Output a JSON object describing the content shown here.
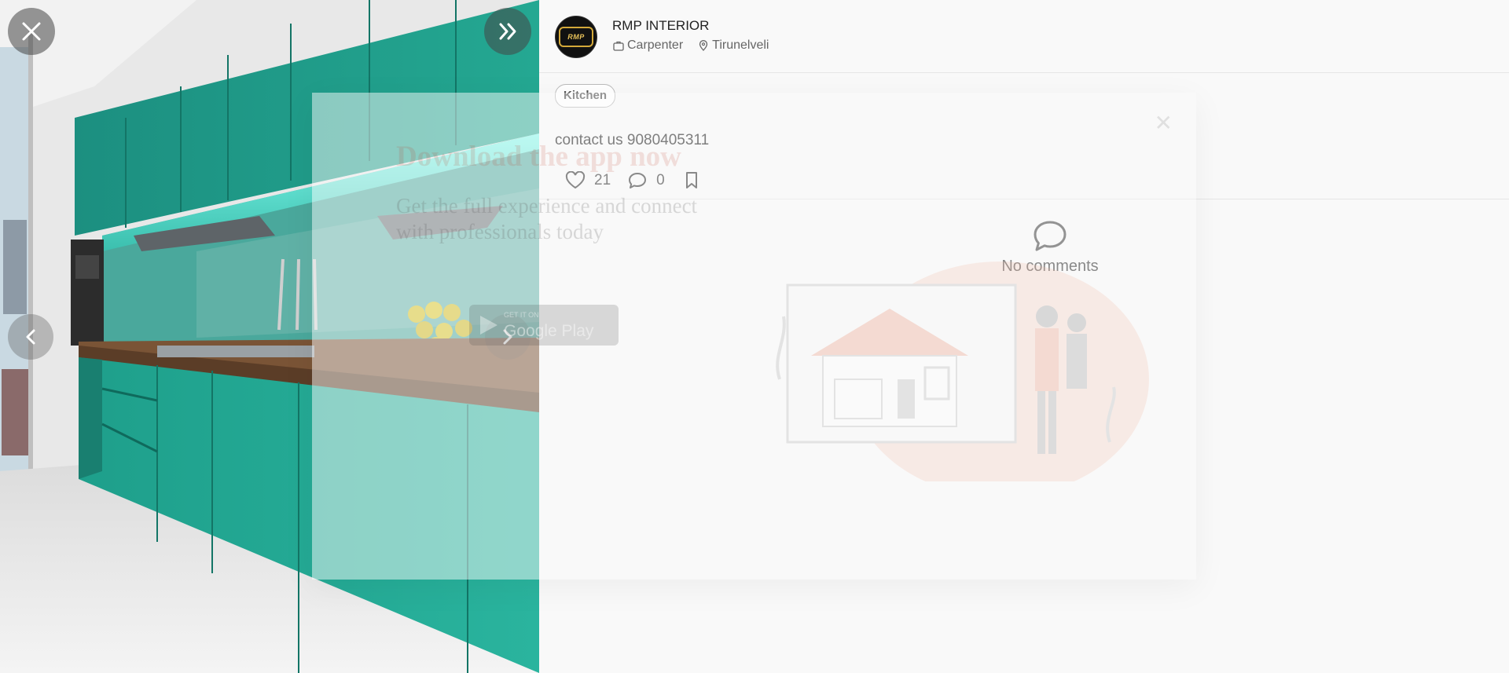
{
  "viewer": {
    "close_icon": "close-icon",
    "expand_icon": "double-chevron-right-icon",
    "prev_icon": "chevron-left-icon",
    "next_icon": "chevron-right-icon"
  },
  "post": {
    "author_name": "RMP INTERIOR",
    "avatar_text": "RMP",
    "profession": "Carpenter",
    "location": "Tirunelveli",
    "tag": "Kitchen",
    "caption": "contact us 9080405311",
    "likes": "21",
    "comments": "0"
  },
  "comments_section": {
    "empty_text": "No comments"
  },
  "popup": {
    "title": "Download the app now",
    "subtitle": "Get the full experience and connect with professionals today",
    "badge_small": "GET IT ON",
    "badge_big": "Google Play"
  },
  "colors": {
    "cabinet": "#1f9a87",
    "accent_glow": "#4ff0dc",
    "panel_bg": "#f9f9f9"
  }
}
